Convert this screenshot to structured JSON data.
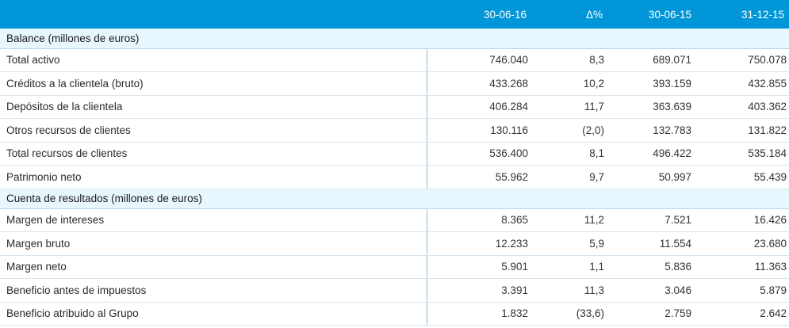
{
  "header": {
    "columns": [
      "30-06-16",
      "Δ%",
      "30-06-15",
      "31-12-15"
    ]
  },
  "sections": [
    {
      "title": "Balance (millones de euros)",
      "rows": [
        {
          "label": "Total activo",
          "values": [
            "746.040",
            "8,3",
            "689.071",
            "750.078"
          ]
        },
        {
          "label": "Créditos a la clientela (bruto)",
          "values": [
            "433.268",
            "10,2",
            "393.159",
            "432.855"
          ]
        },
        {
          "label": "Depósitos de la clientela",
          "values": [
            "406.284",
            "11,7",
            "363.639",
            "403.362"
          ]
        },
        {
          "label": "Otros recursos de clientes",
          "values": [
            "130.116",
            "(2,0)",
            "132.783",
            "131.822"
          ]
        },
        {
          "label": "Total recursos de clientes",
          "values": [
            "536.400",
            "8,1",
            "496.422",
            "535.184"
          ]
        },
        {
          "label": "Patrimonio neto",
          "values": [
            "55.962",
            "9,7",
            "50.997",
            "55.439"
          ]
        }
      ]
    },
    {
      "title": "Cuenta de resultados (millones de euros)",
      "rows": [
        {
          "label": "Margen de intereses",
          "values": [
            "8.365",
            "11,2",
            "7.521",
            "16.426"
          ]
        },
        {
          "label": "Margen bruto",
          "values": [
            "12.233",
            "5,9",
            "11.554",
            "23.680"
          ]
        },
        {
          "label": "Margen neto",
          "values": [
            "5.901",
            "1,1",
            "5.836",
            "11.363"
          ]
        },
        {
          "label": "Beneficio antes de impuestos",
          "values": [
            "3.391",
            "11,3",
            "3.046",
            "5.879"
          ]
        },
        {
          "label": "Beneficio atribuido al Grupo",
          "values": [
            "1.832",
            "(33,6)",
            "2.759",
            "2.642"
          ]
        }
      ]
    }
  ]
}
